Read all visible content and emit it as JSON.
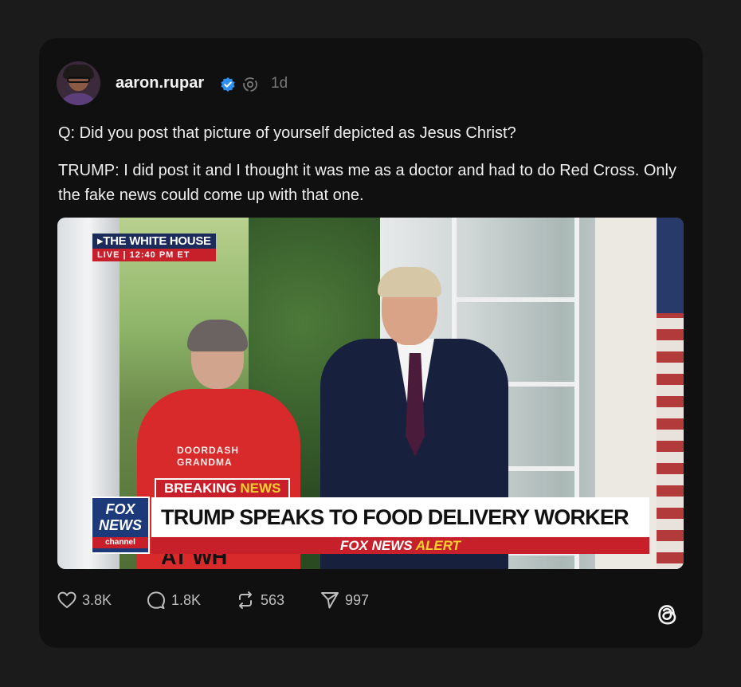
{
  "post": {
    "username": "aaron.rupar",
    "time": "1d",
    "text_1": "Q: Did you post that picture of yourself depicted as Jesus Christ?",
    "text_2": "TRUMP: I did post it and I thought it was me as a doctor and had to do Red Cross. Only the fake news could come up with that one."
  },
  "media": {
    "bug_title": "▸THE WHITE HOUSE",
    "bug_live": "LIVE",
    "bug_time": "12:40 PM ET",
    "shirt_line_1": "DOORDASH",
    "shirt_line_2": "GRANDMA",
    "breaking": "BREAKING",
    "breaking_news": "NEWS",
    "logo_line_1": "FOX",
    "logo_line_2": "NEWS",
    "logo_line_3": "channel",
    "headline": "TRUMP SPEAKS TO FOOD DELIVERY WORKER AT WH",
    "alert_prefix": "FOX NEWS",
    "alert_word": "ALERT"
  },
  "actions": {
    "likes": "3.8K",
    "replies": "1.8K",
    "reposts": "563",
    "shares": "997"
  },
  "icons": {
    "verified": "verified-badge-icon",
    "hub": "threads-hub-icon",
    "like": "heart-icon",
    "reply": "comment-icon",
    "repost": "repost-icon",
    "share": "send-icon",
    "logo": "threads-logo-icon"
  },
  "colors": {
    "background": "#1b1b1b",
    "card": "#101010",
    "verified": "#2f8ff0",
    "fox_red": "#c8202a",
    "fox_yellow": "#f6d02f"
  }
}
